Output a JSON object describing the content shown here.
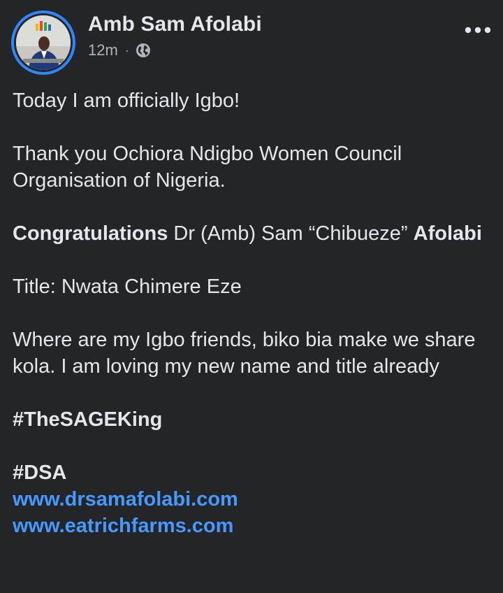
{
  "post": {
    "author": "Amb Sam Afolabi",
    "timestamp": "12m",
    "separator": "·",
    "privacy_icon": "globe-icon",
    "more_icon": "more-dots-icon",
    "avatar": "avatar-photo"
  },
  "content": {
    "line1": "Today I am officially Igbo!",
    "line2": "Thank you Ochiora Ndigbo Women Council Organisation of Nigeria.",
    "congrats_bold": "Congratulations",
    "congrats_rest": " Dr (Amb) Sam “Chibueze” ",
    "congrats_name": "Afolabi",
    "title_line": "Title: Nwata Chimere Eze",
    "where_line": "Where are my Igbo friends, biko bia make we share kola. I am loving my new name and title already",
    "hashtag1": "#TheSAGEKing",
    "hashtag2": "#DSA",
    "link1": "www.drsamafolabi.com",
    "link2": "www.eatrichfarms.com"
  },
  "colors": {
    "background": "#242526",
    "text": "#e4e6eb",
    "secondary": "#b0b3b8",
    "link": "#4599ff",
    "story_ring": "#2d88ff"
  }
}
